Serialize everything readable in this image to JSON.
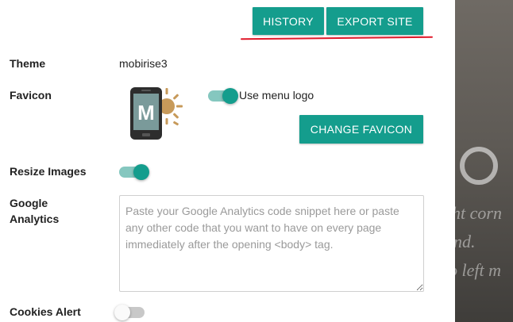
{
  "toolbar": {
    "history_label": "HISTORY",
    "export_label": "EXPORT SITE"
  },
  "settings": {
    "theme": {
      "label": "Theme",
      "value": "mobirise3"
    },
    "favicon": {
      "label": "Favicon",
      "icon_letter": "M",
      "use_menu_logo_label": "Use menu logo",
      "use_menu_logo": true,
      "change_button": "CHANGE FAVICON"
    },
    "resize_images": {
      "label": "Resize Images",
      "enabled": true
    },
    "google_analytics": {
      "label_line1": "Google",
      "label_line2": "Analytics",
      "placeholder": "Paste your Google Analytics code snippet here or paste any other code that you want to have on every page immediately after the opening <body> tag.",
      "value": ""
    },
    "cookies_alert": {
      "label": "Cookies Alert",
      "enabled": false
    }
  },
  "preview": {
    "line1": "ht corn",
    "line2": "nd.",
    "line3": "o left m"
  },
  "colors": {
    "accent": "#149d8d",
    "highlight_underline": "#e0192a"
  }
}
